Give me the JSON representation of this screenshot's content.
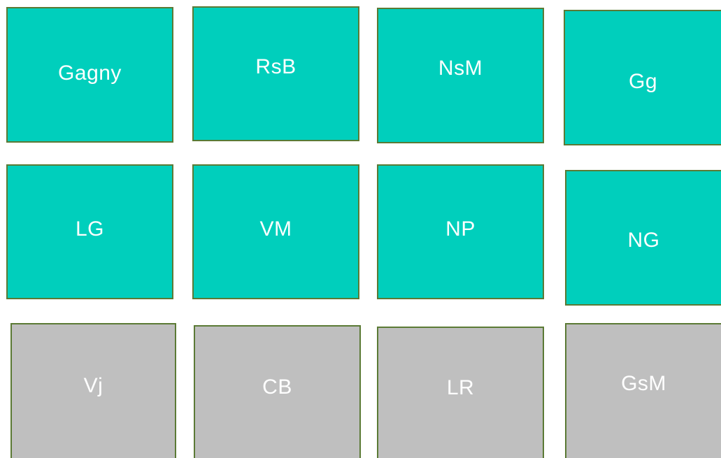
{
  "colors": {
    "active_tile": "#00cfbc",
    "inactive_tile": "#bfbfbf",
    "tile_border": "#5b7a35",
    "label_text": "#ffffff"
  },
  "tiles": [
    {
      "label": "Gagny",
      "state": "active"
    },
    {
      "label": "RsB",
      "state": "active"
    },
    {
      "label": "NsM",
      "state": "active"
    },
    {
      "label": "Gg",
      "state": "active"
    },
    {
      "label": "LG",
      "state": "active"
    },
    {
      "label": "VM",
      "state": "active"
    },
    {
      "label": "NP",
      "state": "active"
    },
    {
      "label": "NG",
      "state": "active"
    },
    {
      "label": "Vj",
      "state": "inactive"
    },
    {
      "label": "CB",
      "state": "inactive"
    },
    {
      "label": "LR",
      "state": "inactive"
    },
    {
      "label": "GsM",
      "state": "inactive"
    }
  ]
}
